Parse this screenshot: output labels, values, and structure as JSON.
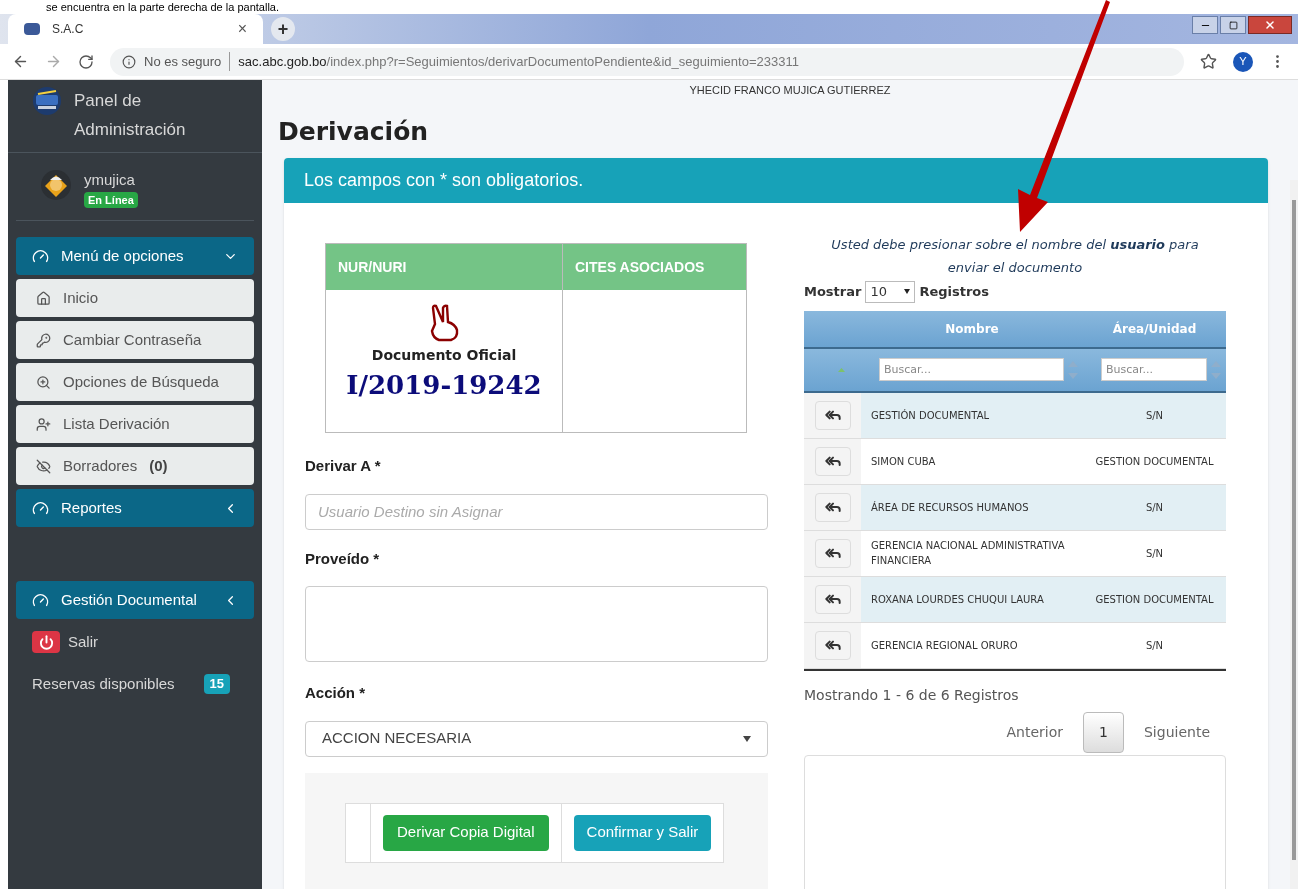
{
  "caption": "se encuentra en la parte derecha de la pantalla.",
  "browser": {
    "tab_title": "S.A.C",
    "tab_close": "×",
    "new_tab": "+",
    "security": "No es seguro",
    "url_host": "sac.abc.gob.bo",
    "url_path": "/index.php?r=Seguimientos/derivarDocumentoPendiente&id_seguimiento=233311",
    "profile": "Y"
  },
  "sidebar": {
    "brand": "Panel de Administración",
    "user": "ymujica",
    "status": "En Línea",
    "items": [
      {
        "kind": "header",
        "label": "Menú de opciones",
        "expanded": true
      },
      {
        "kind": "link",
        "label": "Inicio"
      },
      {
        "kind": "link",
        "label": "Cambiar Contraseña"
      },
      {
        "kind": "link",
        "label": "Opciones de Búsqueda"
      },
      {
        "kind": "link",
        "label": "Lista Derivación"
      },
      {
        "kind": "link",
        "label": "Borradores",
        "count": "(0)"
      },
      {
        "kind": "header",
        "label": "Reportes",
        "expanded": false
      },
      {
        "kind": "spacer"
      },
      {
        "kind": "header",
        "label": "Gestión Documental",
        "expanded": false
      },
      {
        "kind": "logout",
        "label": "Salir"
      },
      {
        "kind": "info",
        "label": "Reservas disponibles",
        "count": "15"
      }
    ]
  },
  "top_user": "YHECID FRANCO MUJICA GUTIERREZ",
  "page_title": "Derivación",
  "card": {
    "header": "Los campos con * son obligatorios.",
    "doc_table": {
      "columns": [
        "NUR/NURI",
        "CITES ASOCIADOS"
      ],
      "doc_type": "Documento Oficial",
      "doc_number": "I/2019-19242"
    },
    "form": {
      "derivar_label": "Derivar A *",
      "derivar_placeholder": "Usuario Destino sin Asignar",
      "proveido_label": "Proveído *",
      "accion_label": "Acción *",
      "accion_value": "ACCION NECESARIA"
    },
    "buttons": [
      "Derivar Copia Digital",
      "Confirmar y Salir"
    ],
    "instruction": "Usted debe presionar sobre el nombre del **usuario** para enviar el documento",
    "show": {
      "prefix": "Mostrar",
      "value": "10",
      "suffix": "Registros"
    },
    "table": {
      "columns": [
        "Nombre",
        "Área/Unidad"
      ],
      "filter_placeholders": [
        "Buscar...",
        "Buscar..."
      ],
      "rows": [
        {
          "nombre": "GESTIÓN DOCUMENTAL",
          "area": "S/N"
        },
        {
          "nombre": "SIMON CUBA",
          "area": "GESTION DOCUMENTAL"
        },
        {
          "nombre": "ÁREA DE RECURSOS HUMANOS",
          "area": "S/N"
        },
        {
          "nombre": "GERENCIA NACIONAL ADMINISTRATIVA FINANCIERA",
          "area": "S/N"
        },
        {
          "nombre": "ROXANA LOURDES CHUQUI LAURA",
          "area": "GESTION DOCUMENTAL"
        },
        {
          "nombre": "GERENCIA REGIONAL ORURO",
          "area": "S/N"
        }
      ]
    },
    "summary": "Mostrando 1 - 6 de 6 Registros",
    "pager": [
      {
        "label": "Anterior",
        "selected": false
      },
      {
        "label": "1",
        "selected": true
      },
      {
        "label": "Siguiente",
        "selected": false
      }
    ]
  }
}
